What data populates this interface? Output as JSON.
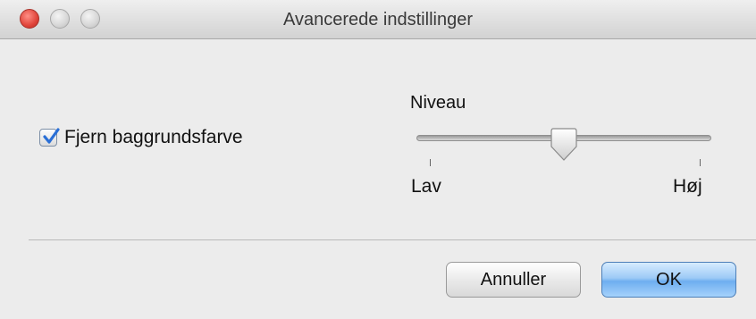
{
  "window": {
    "title": "Avancerede indstillinger",
    "buttons": [
      "close",
      "minimize",
      "zoom"
    ]
  },
  "remove_background": {
    "label": "Fjern baggrundsfarve",
    "checked": true
  },
  "level": {
    "title": "Niveau",
    "low_label": "Lav",
    "high_label": "Høj",
    "value": 0.5
  },
  "actions": {
    "cancel_label": "Annuller",
    "ok_label": "OK"
  },
  "colors": {
    "close": "#e0443a",
    "default_button": "#6eaef0",
    "checkmark": "#2a6fd6"
  }
}
